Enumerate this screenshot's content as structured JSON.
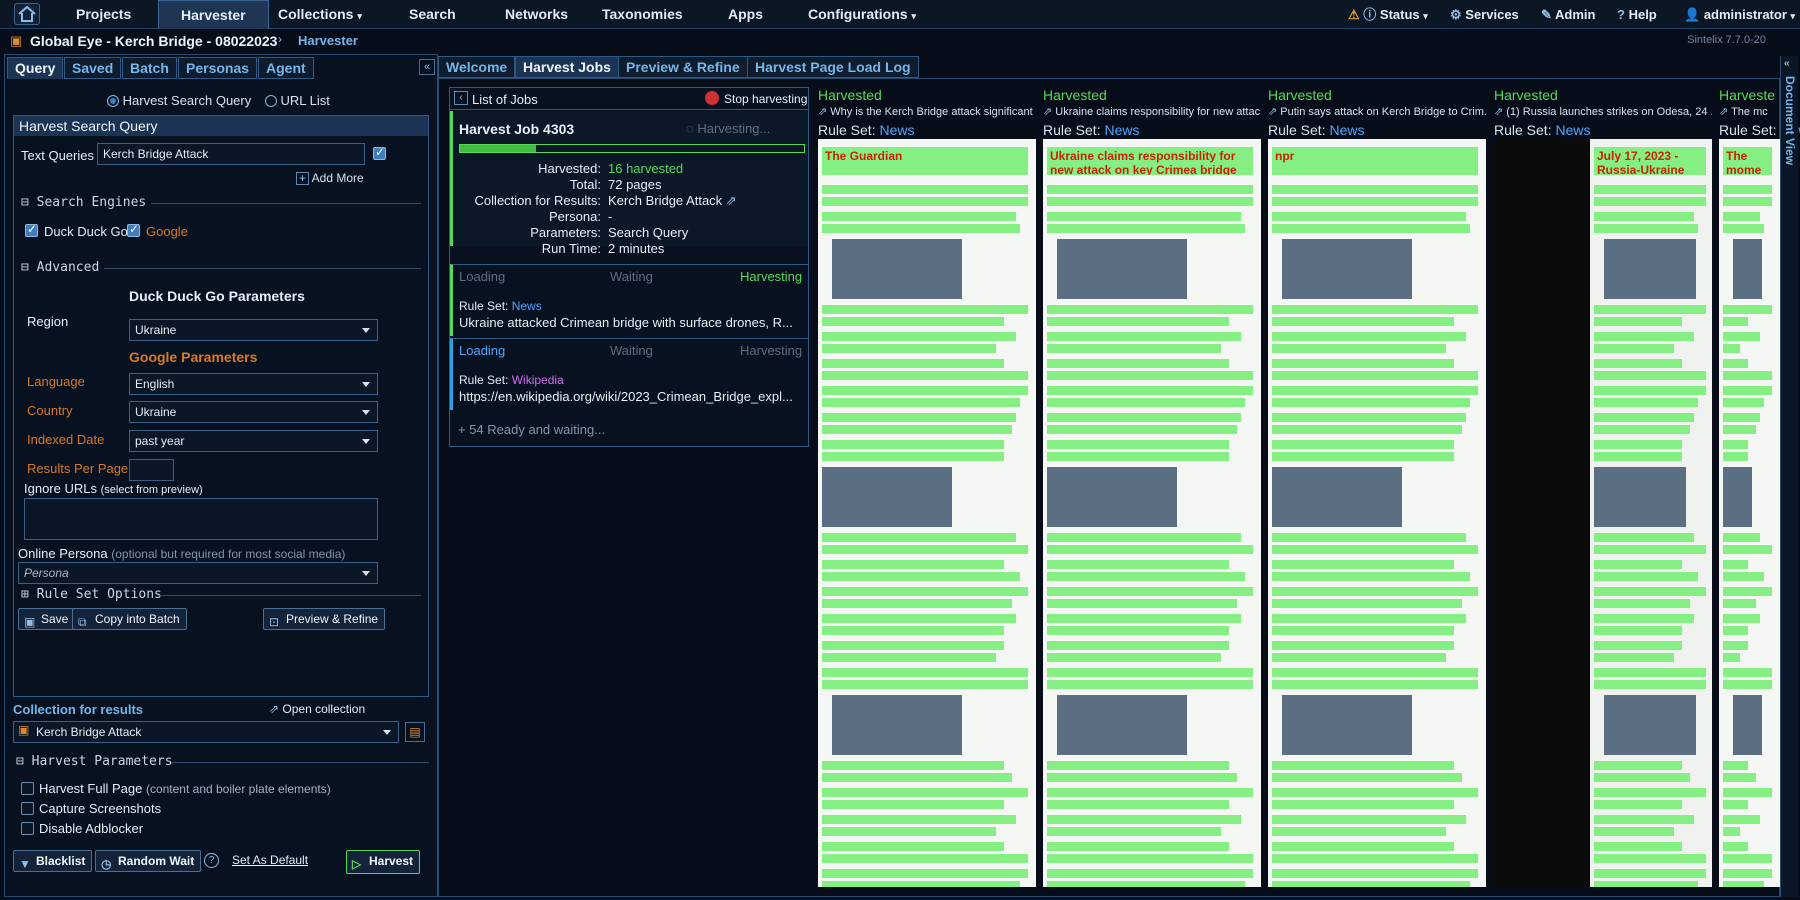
{
  "nav": {
    "items": [
      "Projects",
      "Harvester",
      "Collections",
      "Search",
      "Networks",
      "Taxonomies",
      "Apps",
      "Configurations"
    ],
    "status": "Status",
    "services": "Services",
    "admin": "Admin",
    "help": "Help",
    "user": "administrator"
  },
  "crumb": {
    "project": "Global Eye - Kerch Bridge - 08022023",
    "page": "Harvester",
    "version": "Sintelix 7.7.0-20"
  },
  "left": {
    "tabs": [
      "Query",
      "Saved",
      "Batch",
      "Personas",
      "Agent"
    ],
    "mode_search": "Harvest Search Query",
    "mode_url": "URL List",
    "box_title": "Harvest Search Query",
    "text_queries_label": "Text Queries",
    "text_queries_value": "Kerch Bridge Attack",
    "add_more": "Add More",
    "search_engines": "Search Engines",
    "ddg": "Duck Duck Go",
    "google": "Google",
    "advanced": "Advanced",
    "ddg_params": "Duck Duck Go Parameters",
    "region_label": "Region",
    "region_value": "Ukraine",
    "google_params": "Google Parameters",
    "language_label": "Language",
    "language_value": "English",
    "country_label": "Country",
    "country_value": "Ukraine",
    "indexed_label": "Indexed Date",
    "indexed_value": "past year",
    "results_label": "Results Per Page",
    "ignore_label": "Ignore URLs",
    "ignore_hint": "(select from preview)",
    "persona_label": "Online Persona",
    "persona_hint": "(optional but required for most social media)",
    "persona_placeholder": "Persona",
    "rule_set_options": "Rule Set Options",
    "save": "Save",
    "copy_batch": "Copy into Batch",
    "preview_refine": "Preview & Refine",
    "collection_label": "Collection for results",
    "open_collection": "Open collection",
    "collection_value": "Kerch Bridge Attack",
    "harvest_params": "Harvest Parameters",
    "full_page": "Harvest Full Page",
    "full_page_hint": "(content and boiler plate elements)",
    "capture": "Capture Screenshots",
    "adblock": "Disable Adblocker",
    "blacklist": "Blacklist",
    "random_wait": "Random Wait",
    "set_default": "Set As Default",
    "harvest": "Harvest"
  },
  "tabs": [
    "Welcome",
    "Harvest Jobs",
    "Preview & Refine",
    "Harvest Page Load Log"
  ],
  "jobs": {
    "list": "List of Jobs",
    "stop": "Stop harvesting",
    "title": "Harvest Job 4303",
    "harvesting": "Harvesting...",
    "progress": 0.22,
    "harvested_label": "Harvested:",
    "harvested_value": "16 harvested",
    "total_label": "Total:",
    "total_value": "72 pages",
    "collection_label": "Collection for Results:",
    "collection_value": "Kerch Bridge Attack",
    "persona_label": "Persona:",
    "persona_value": "-",
    "params_label": "Parameters:",
    "params_value": "Search Query",
    "runtime_label": "Run Time:",
    "runtime_value": "2 minutes",
    "stage_loading": "Loading",
    "stage_waiting": "Waiting",
    "stage_harvesting": "Harvesting",
    "rule_label": "Rule Set:",
    "rule1": "News",
    "item1": "Ukraine attacked Crimean bridge with surface drones, R...",
    "rule2": "Wikipedia",
    "item2": "https://en.wikipedia.org/wiki/2023_Crimean_Bridge_expl...",
    "more": "+ 54 Ready and waiting..."
  },
  "previews": [
    {
      "status": "Harvested",
      "title": "Why is the Kerch Bridge attack significant t...",
      "rule": "News",
      "site": "The Guardian"
    },
    {
      "status": "Harvested",
      "title": "Ukraine claims responsibility for new attac...",
      "rule": "News",
      "site": "Ukraine claims responsibility for new attack on key Crimea bridge"
    },
    {
      "status": "Harvested",
      "title": "Putin says attack on Kerch Bridge to Crim...",
      "rule": "News",
      "site": "npr"
    },
    {
      "status": "Harvested",
      "title": "(1) Russia launches strikes on Odesa, 24 ...",
      "rule": "News",
      "site": "July 17, 2023 - Russia-Ukraine news"
    },
    {
      "status": "Harveste",
      "title": "The mc",
      "rule": "News",
      "site": "The mome drone a"
    }
  ],
  "docview": "Document View"
}
